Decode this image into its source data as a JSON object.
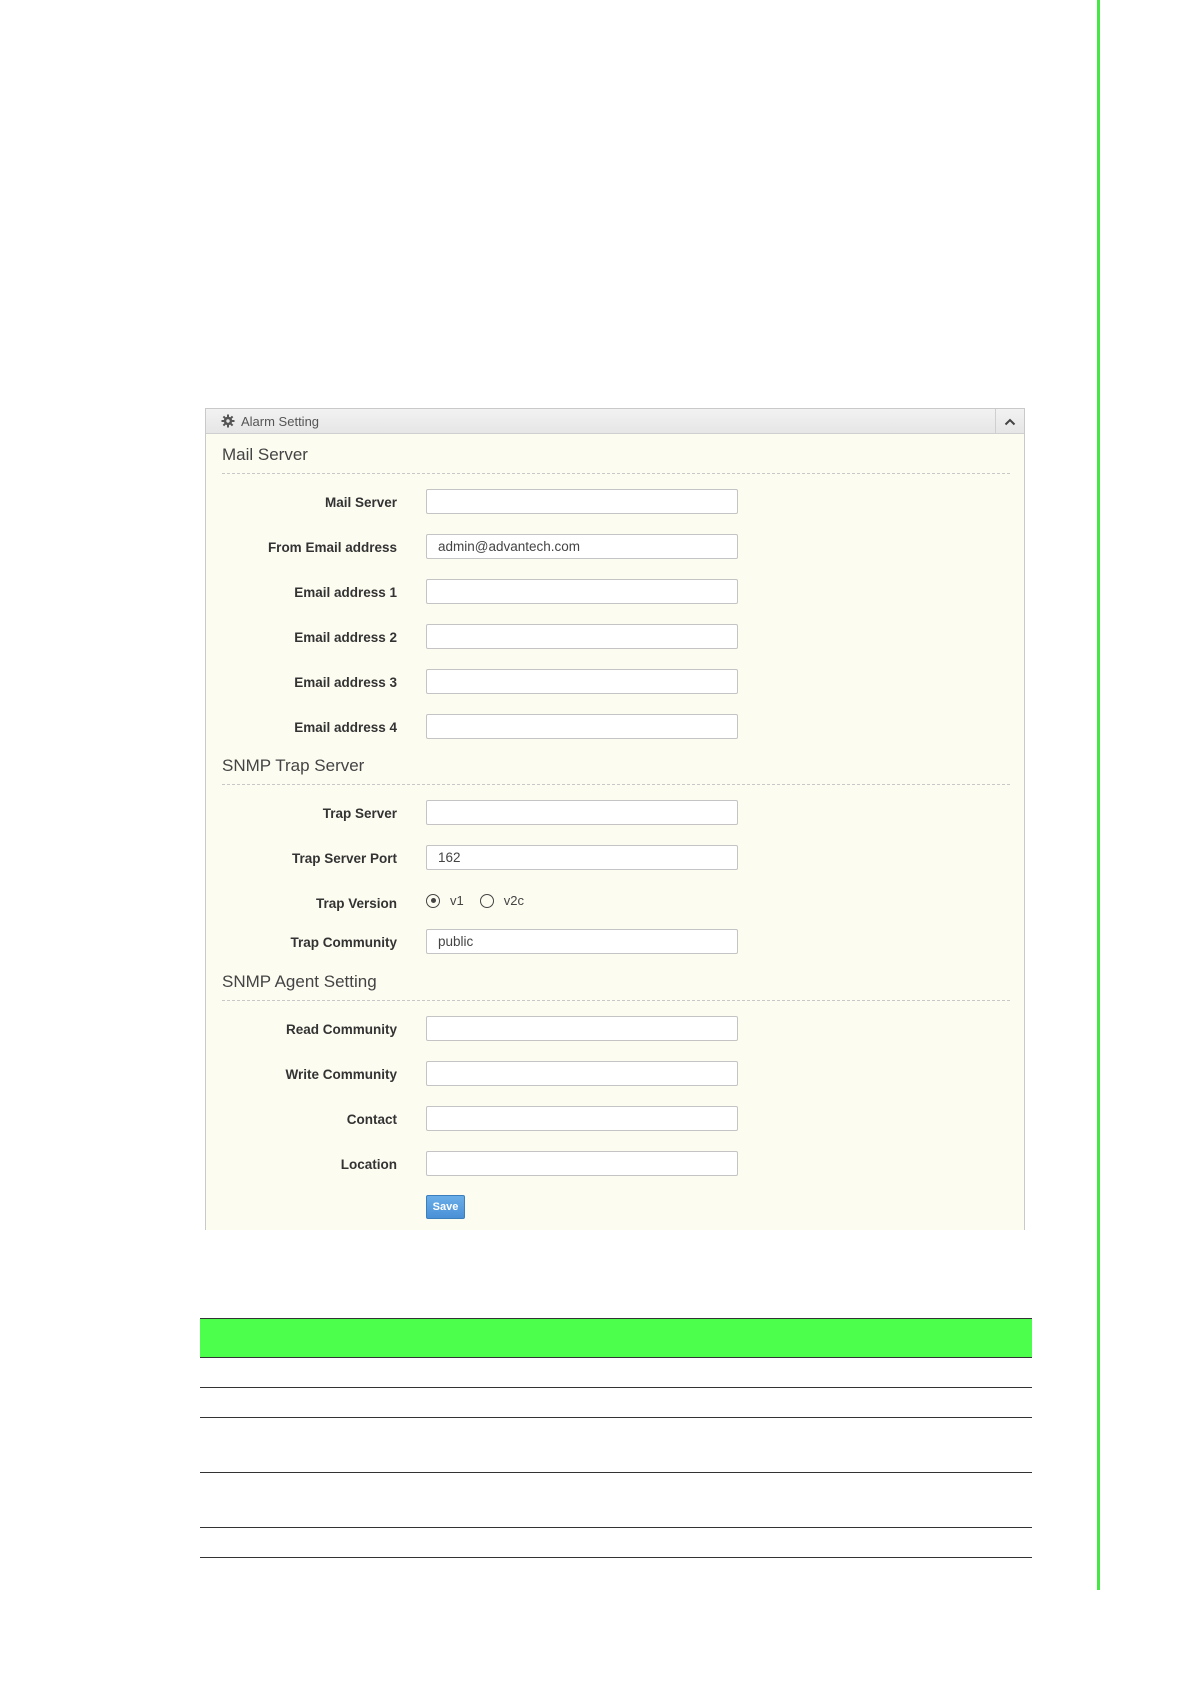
{
  "panel": {
    "title": "Alarm Setting",
    "header_icon": "gear-icon",
    "collapse_icon": "chevron-up-icon"
  },
  "mail_server": {
    "section_title": "Mail Server",
    "fields": [
      {
        "label": "Mail Server",
        "value": ""
      },
      {
        "label": "From Email address",
        "value": "admin@advantech.com"
      },
      {
        "label": "Email address 1",
        "value": ""
      },
      {
        "label": "Email address 2",
        "value": ""
      },
      {
        "label": "Email address 3",
        "value": ""
      },
      {
        "label": "Email address 4",
        "value": ""
      }
    ]
  },
  "snmp_trap": {
    "section_title": "SNMP Trap Server",
    "trap_server": {
      "label": "Trap Server",
      "value": ""
    },
    "trap_server_port": {
      "label": "Trap Server Port",
      "value": "162"
    },
    "trap_version": {
      "label": "Trap Version",
      "options": [
        {
          "label": "v1",
          "checked": true
        },
        {
          "label": "v2c",
          "checked": false
        }
      ]
    },
    "trap_community": {
      "label": "Trap Community",
      "value": "public"
    }
  },
  "snmp_agent": {
    "section_title": "SNMP Agent Setting",
    "fields": [
      {
        "label": "Read Community",
        "value": ""
      },
      {
        "label": "Write Community",
        "value": ""
      },
      {
        "label": "Contact",
        "value": ""
      },
      {
        "label": "Location",
        "value": ""
      }
    ]
  },
  "save_label": "Save",
  "colors": {
    "accent_green": "#4cff4c",
    "panel_background": "#fdfcf1",
    "save_button": "#4a90d6"
  }
}
